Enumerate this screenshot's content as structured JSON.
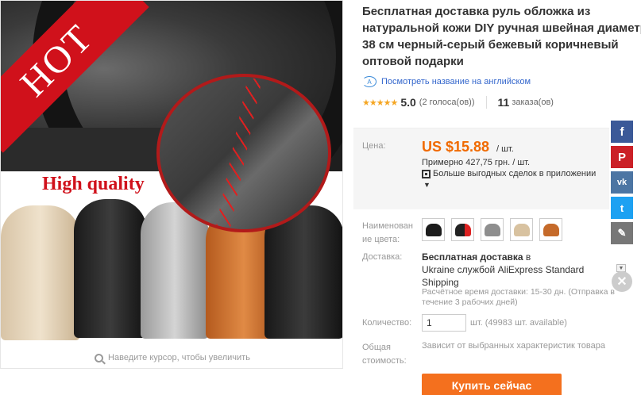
{
  "image": {
    "hot_banner": "HOT",
    "quality_label": "High quality",
    "zoom_hint": "Наведите курсор, чтобы увеличить"
  },
  "product": {
    "title_lines": [
      "Бесплатная доставка руль обложка из",
      "натуральной кожи DIY ручная швейная диаметр",
      "38 см черный-серый бежевый коричневый",
      "оптовой подарки"
    ],
    "translate_link": "Посмотреть название на английском",
    "rating": {
      "stars": "★★★★★",
      "value": "5.0",
      "votes": "(2 голоса(ов))",
      "orders_count": "11",
      "orders_label": "заказа(ов)"
    }
  },
  "price": {
    "label": "Цена:",
    "value": "US $15.88",
    "unit": "/ шт.",
    "approx": "Примерно 427,75 грн. / шт.",
    "app_deals": "Больше выгодных сделок в приложении",
    "caret": "▼"
  },
  "colors": {
    "label": "Наименован ие цвета:",
    "options": [
      "black",
      "black-red",
      "gray",
      "beige",
      "brown"
    ]
  },
  "shipping": {
    "label": "Доставка:",
    "free": "Бесплатная доставка",
    "in": "в",
    "method": "Ukraine службой AliExpress Standard Shipping",
    "note": "Расчётное время доставки: 15-30 дн. (Отправка в течение 3 рабочих дней)"
  },
  "quantity": {
    "label": "Количество:",
    "value": "1",
    "unit": "шт. (49983 шт. available)"
  },
  "total": {
    "label": "Общая стоимость:",
    "note": "Зависит от выбранных характеристик товара"
  },
  "buy_button": "Купить сейчас",
  "social": {
    "facebook": "f",
    "pinterest": "P",
    "vk": "vk",
    "twitter": "t",
    "edit": "✎",
    "close": "✕"
  },
  "colors_hex": {
    "accent": "#f06a00",
    "button": "#f4701e",
    "link": "#3366cc"
  }
}
